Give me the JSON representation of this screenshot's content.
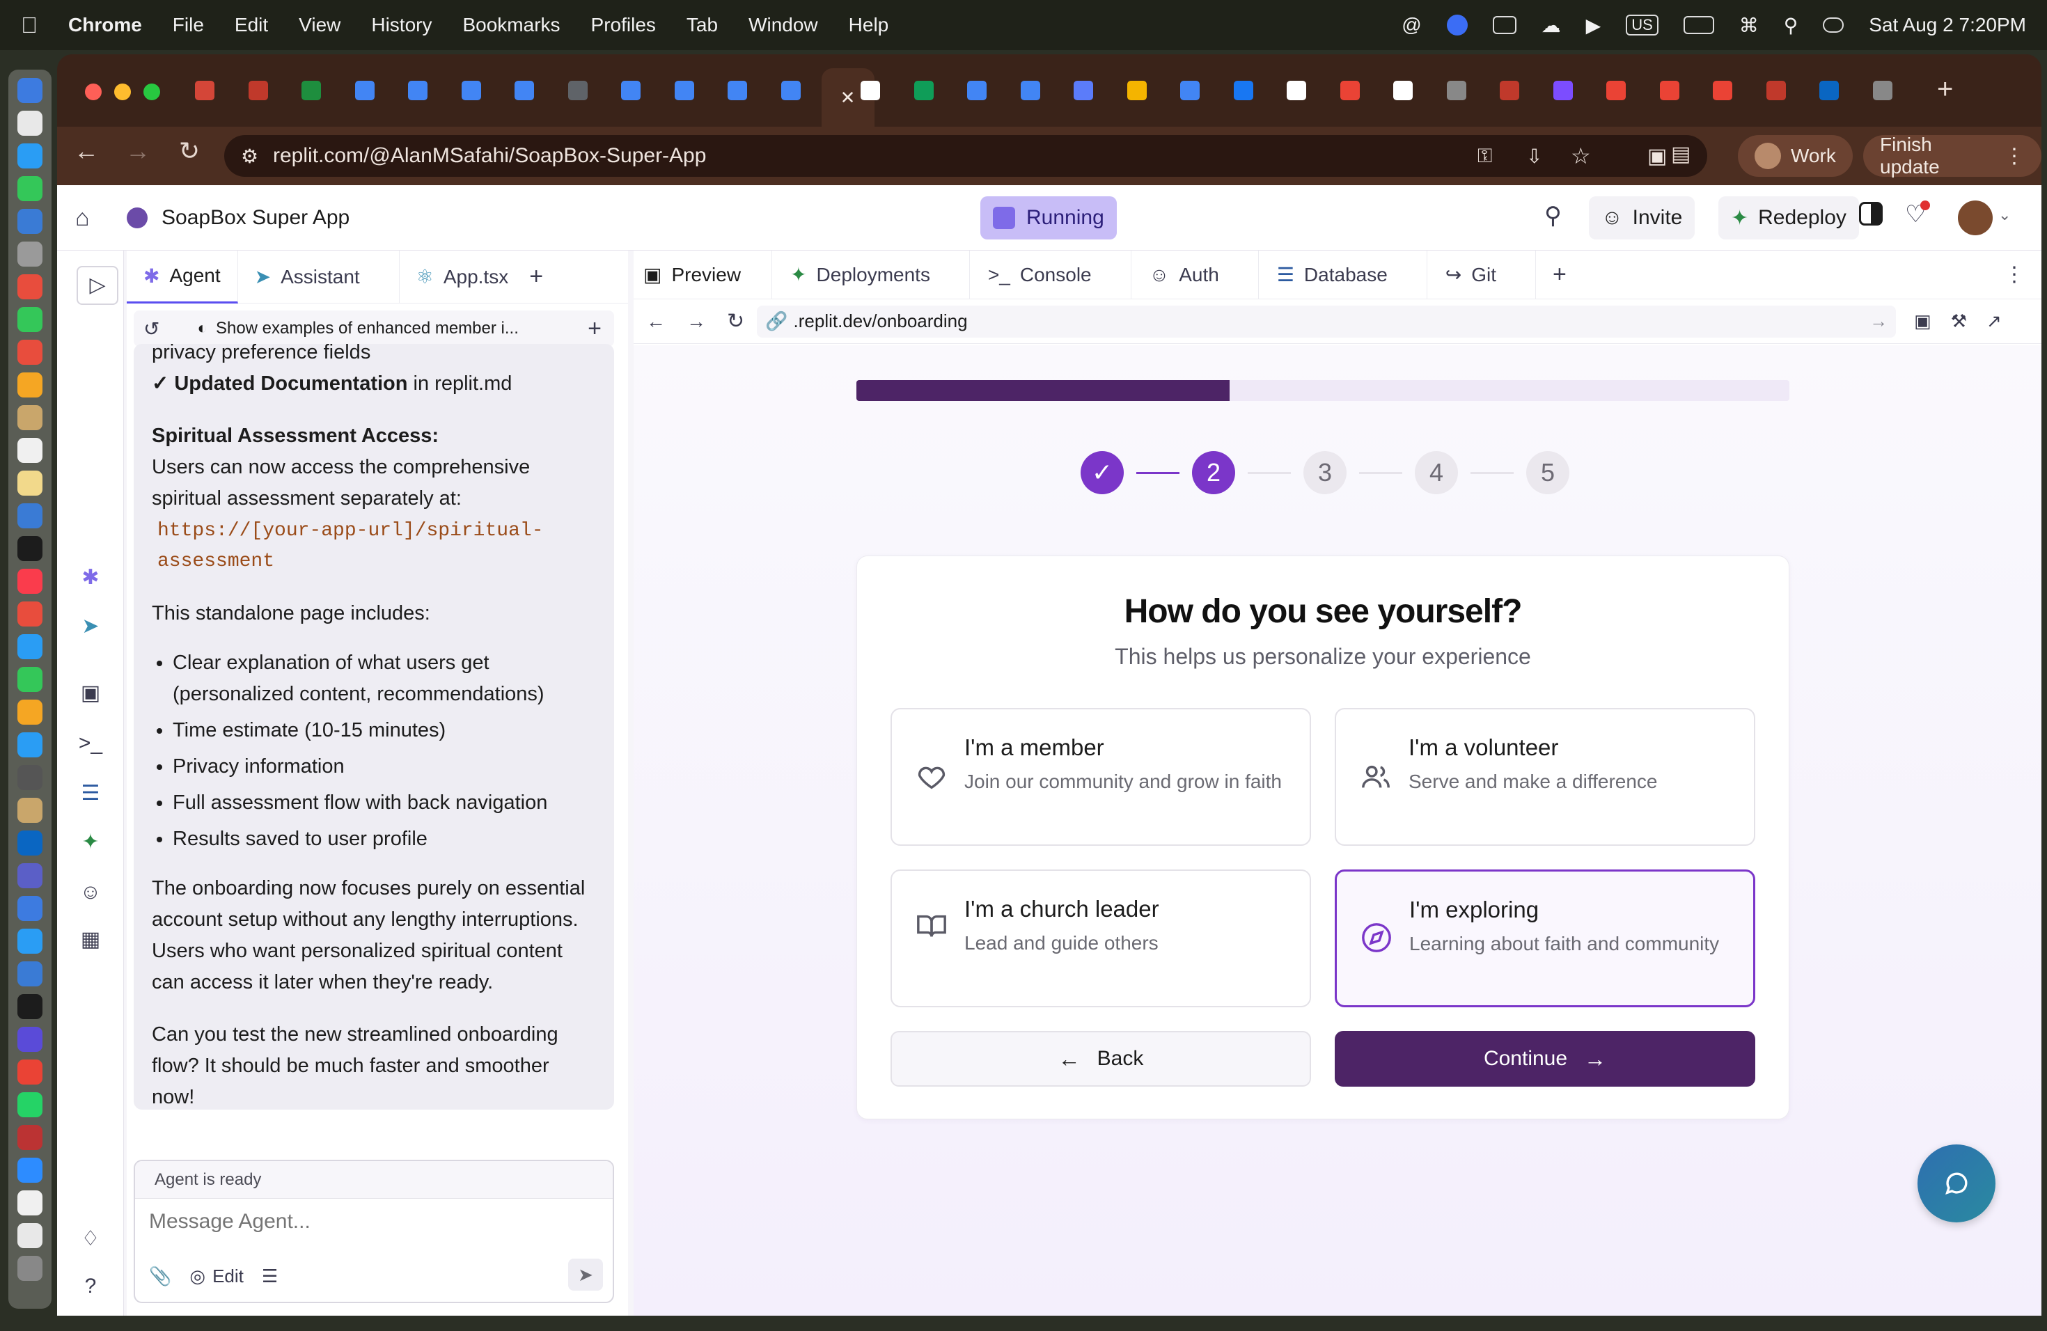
{
  "menubar": {
    "app": "Chrome",
    "items": [
      "File",
      "Edit",
      "View",
      "History",
      "Bookmarks",
      "Profiles",
      "Tab",
      "Window",
      "Help"
    ],
    "keyboard": "US",
    "datetime": "Sat Aug 2  7:20PM"
  },
  "browser": {
    "url": "replit.com/@AlanMSafahi/SoapBox-Super-App",
    "profile_label": "Work",
    "update_label": "Finish update",
    "tab_favicon_colors": [
      "#d44638",
      "#c0392b",
      "#1e8e3e",
      "#4285f4",
      "#4285f4",
      "#4285f4",
      "#4285f4",
      "#5f6368",
      "#4285f4",
      "#4285f4",
      "#4285f4",
      "#4285f4",
      "#ffffff",
      "#0f9d58",
      "#4285f4",
      "#4285f4",
      "#5b7cfa",
      "#f4b400",
      "#4285f4",
      "#1877f2",
      "#ffffff",
      "#ea4335",
      "#ffffff",
      "#888888",
      "#c0392b",
      "#7c4dff",
      "#ea4335",
      "#ea4335",
      "#ea4335",
      "#c0392b",
      "#0a66c2",
      "#888888"
    ]
  },
  "app": {
    "project_name": "SoapBox Super App",
    "run_status": "Running",
    "invite_label": "Invite",
    "redeploy_label": "Redeploy"
  },
  "agent_pane": {
    "tabs": [
      {
        "label": "Agent",
        "icon": "replit-agent-icon"
      },
      {
        "label": "Assistant",
        "icon": "assistant-icon"
      },
      {
        "label": "App.tsx",
        "icon": "react-icon"
      }
    ],
    "thread_title": "Show examples of enhanced member i...",
    "message": {
      "line_privacy": "privacy preference fields",
      "updated_doc_bold": "✓ Updated Documentation",
      "updated_doc_rest": " in replit.md",
      "access_heading": "Spiritual Assessment Access:",
      "access_text": "Users can now access the comprehensive spiritual assessment separately at:",
      "access_url": "https://[your-app-url]/spiritual-assessment",
      "includes": "This standalone page includes:",
      "bullets": [
        "Clear explanation of what users get (personalized content, recommendations)",
        "Time estimate (10-15 minutes)",
        "Privacy information",
        "Full assessment flow with back navigation",
        "Results saved to user profile"
      ],
      "summary": "The onboarding now focuses purely on essential account setup without any lengthy interruptions. Users who want personalized spiritual content can access it later when they're ready.",
      "question": "Can you test the new streamlined onboarding flow? It should be much faster and smoother now!"
    },
    "status": "Agent is ready",
    "input_placeholder": "Message Agent...",
    "edit_label": "Edit"
  },
  "right_pane": {
    "tabs": [
      {
        "label": "Preview",
        "icon": "monitor-icon"
      },
      {
        "label": "Deployments",
        "icon": "deploy-icon"
      },
      {
        "label": "Console",
        "icon": "terminal-icon"
      },
      {
        "label": "Auth",
        "icon": "auth-icon"
      },
      {
        "label": "Database",
        "icon": "database-icon"
      },
      {
        "label": "Git",
        "icon": "git-icon"
      }
    ],
    "preview_url": ".replit.dev/onboarding"
  },
  "onboarding": {
    "progress": 0.4,
    "steps": [
      "2",
      "3",
      "4",
      "5"
    ],
    "current_step": 2,
    "title": "How do you see yourself?",
    "subtitle": "This helps us personalize your experience",
    "options": [
      {
        "title": "I'm a member",
        "desc": "Join our community and grow in faith",
        "icon": "heart-icon",
        "selected": false
      },
      {
        "title": "I'm a volunteer",
        "desc": "Serve and make a difference",
        "icon": "users-icon",
        "selected": false
      },
      {
        "title": "I'm a church leader",
        "desc": "Lead and guide others",
        "icon": "book-icon",
        "selected": false
      },
      {
        "title": "I'm exploring",
        "desc": "Learning about faith and community",
        "icon": "compass-icon",
        "selected": true
      }
    ],
    "back_label": "Back",
    "continue_label": "Continue",
    "accent_color": "#7b36c9",
    "primary_button_color": "#4d2466"
  }
}
